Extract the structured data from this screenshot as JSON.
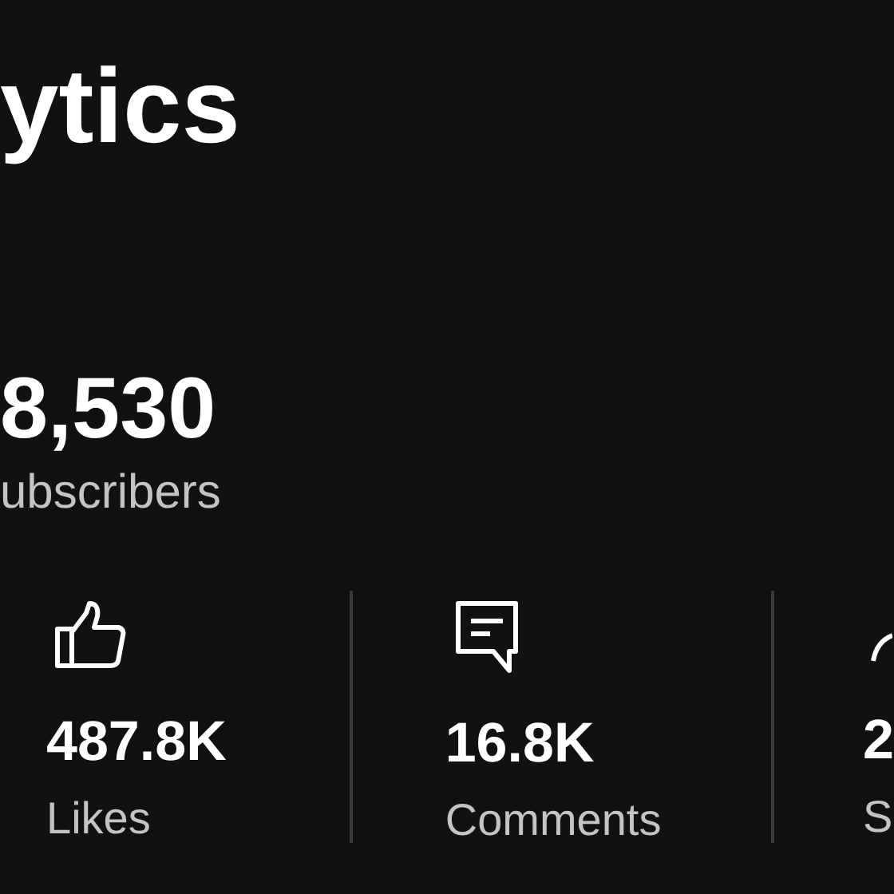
{
  "header": {
    "title": "ytics"
  },
  "subscribers": {
    "count": "8,530",
    "label": "ubscribers"
  },
  "stats": [
    {
      "kind": "likes",
      "value": "487.8K",
      "label": "Likes"
    },
    {
      "kind": "comments",
      "value": "16.8K",
      "label": "Comments"
    },
    {
      "kind": "shares",
      "value": "2",
      "label": "S"
    }
  ]
}
